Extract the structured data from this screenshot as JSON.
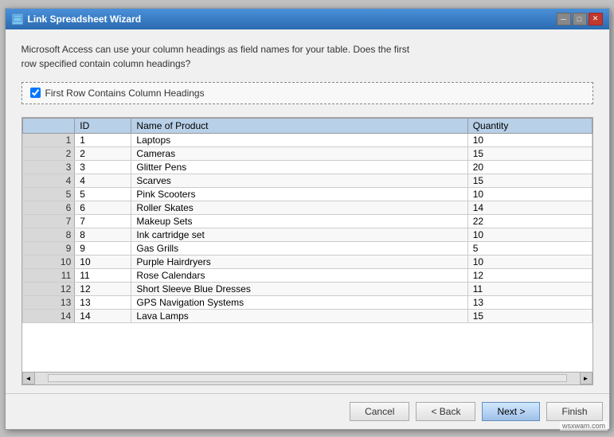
{
  "window": {
    "title": "Link Spreadsheet Wizard",
    "close_btn": "✕",
    "min_btn": "─",
    "max_btn": "□"
  },
  "description": {
    "line1": "Microsoft Access can use your column headings as field names for your table. Does the first",
    "line2": "row specified contain column headings?"
  },
  "checkbox": {
    "label": "First Row Contains Column Headings",
    "checked": true
  },
  "table": {
    "columns": [
      {
        "key": "rownum",
        "label": ""
      },
      {
        "key": "id",
        "label": "ID"
      },
      {
        "key": "name",
        "label": "Name of Product"
      },
      {
        "key": "qty",
        "label": "Quantity"
      }
    ],
    "rows": [
      {
        "rownum": "1",
        "id": "1",
        "name": "Laptops",
        "qty": "10"
      },
      {
        "rownum": "2",
        "id": "2",
        "name": "Cameras",
        "qty": "15"
      },
      {
        "rownum": "3",
        "id": "3",
        "name": "Glitter Pens",
        "qty": "20"
      },
      {
        "rownum": "4",
        "id": "4",
        "name": "Scarves",
        "qty": "15"
      },
      {
        "rownum": "5",
        "id": "5",
        "name": "Pink Scooters",
        "qty": "10"
      },
      {
        "rownum": "6",
        "id": "6",
        "name": "Roller Skates",
        "qty": "14"
      },
      {
        "rownum": "7",
        "id": "7",
        "name": "Makeup Sets",
        "qty": "22"
      },
      {
        "rownum": "8",
        "id": "8",
        "name": "Ink cartridge set",
        "qty": "10"
      },
      {
        "rownum": "9",
        "id": "9",
        "name": "Gas Grills",
        "qty": "5"
      },
      {
        "rownum": "10",
        "id": "10",
        "name": "Purple Hairdryers",
        "qty": "10"
      },
      {
        "rownum": "11",
        "id": "11",
        "name": "Rose Calendars",
        "qty": "12"
      },
      {
        "rownum": "12",
        "id": "12",
        "name": "Short Sleeve Blue Dresses",
        "qty": "11"
      },
      {
        "rownum": "13",
        "id": "13",
        "name": "GPS Navigation Systems",
        "qty": "13"
      },
      {
        "rownum": "14",
        "id": "14",
        "name": "Lava Lamps",
        "qty": "15"
      }
    ]
  },
  "buttons": {
    "cancel": "Cancel",
    "back": "< Back",
    "next": "Next >",
    "finish": "Finish"
  },
  "watermark": "wsxwam.com"
}
